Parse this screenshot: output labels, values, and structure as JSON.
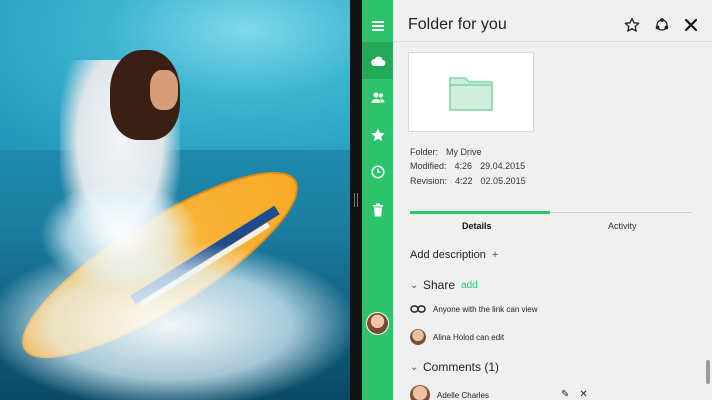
{
  "header": {
    "title": "Folder for you"
  },
  "rail": {
    "items": [
      {
        "icon": "menu-icon"
      },
      {
        "icon": "cloud-icon",
        "active": true
      },
      {
        "icon": "people-icon"
      },
      {
        "icon": "star-icon"
      },
      {
        "icon": "clock-icon"
      },
      {
        "icon": "trash-icon"
      }
    ]
  },
  "meta": {
    "folder_label": "Folder:",
    "folder_value": "My Drive",
    "modified_label": "Modified:",
    "modified_time": "4:26",
    "modified_date": "29.04.2015",
    "revision_label": "Revision:",
    "revision_time": "4:22",
    "revision_date": "02.05.2015"
  },
  "tabs": [
    {
      "label": "Details",
      "active": true
    },
    {
      "label": "Activity",
      "active": false
    }
  ],
  "add_description": "Add description",
  "share": {
    "title": "Share",
    "add_label": "add",
    "link_text": "Anyone with the link can view",
    "user_text": "Alina Holod can edit"
  },
  "comments": {
    "title": "Comments (1)",
    "author": "Adelle Charles"
  },
  "colors": {
    "accent": "#2dc36b",
    "accent_dark": "#24a85a",
    "pane_bg": "#f0f0f0"
  }
}
